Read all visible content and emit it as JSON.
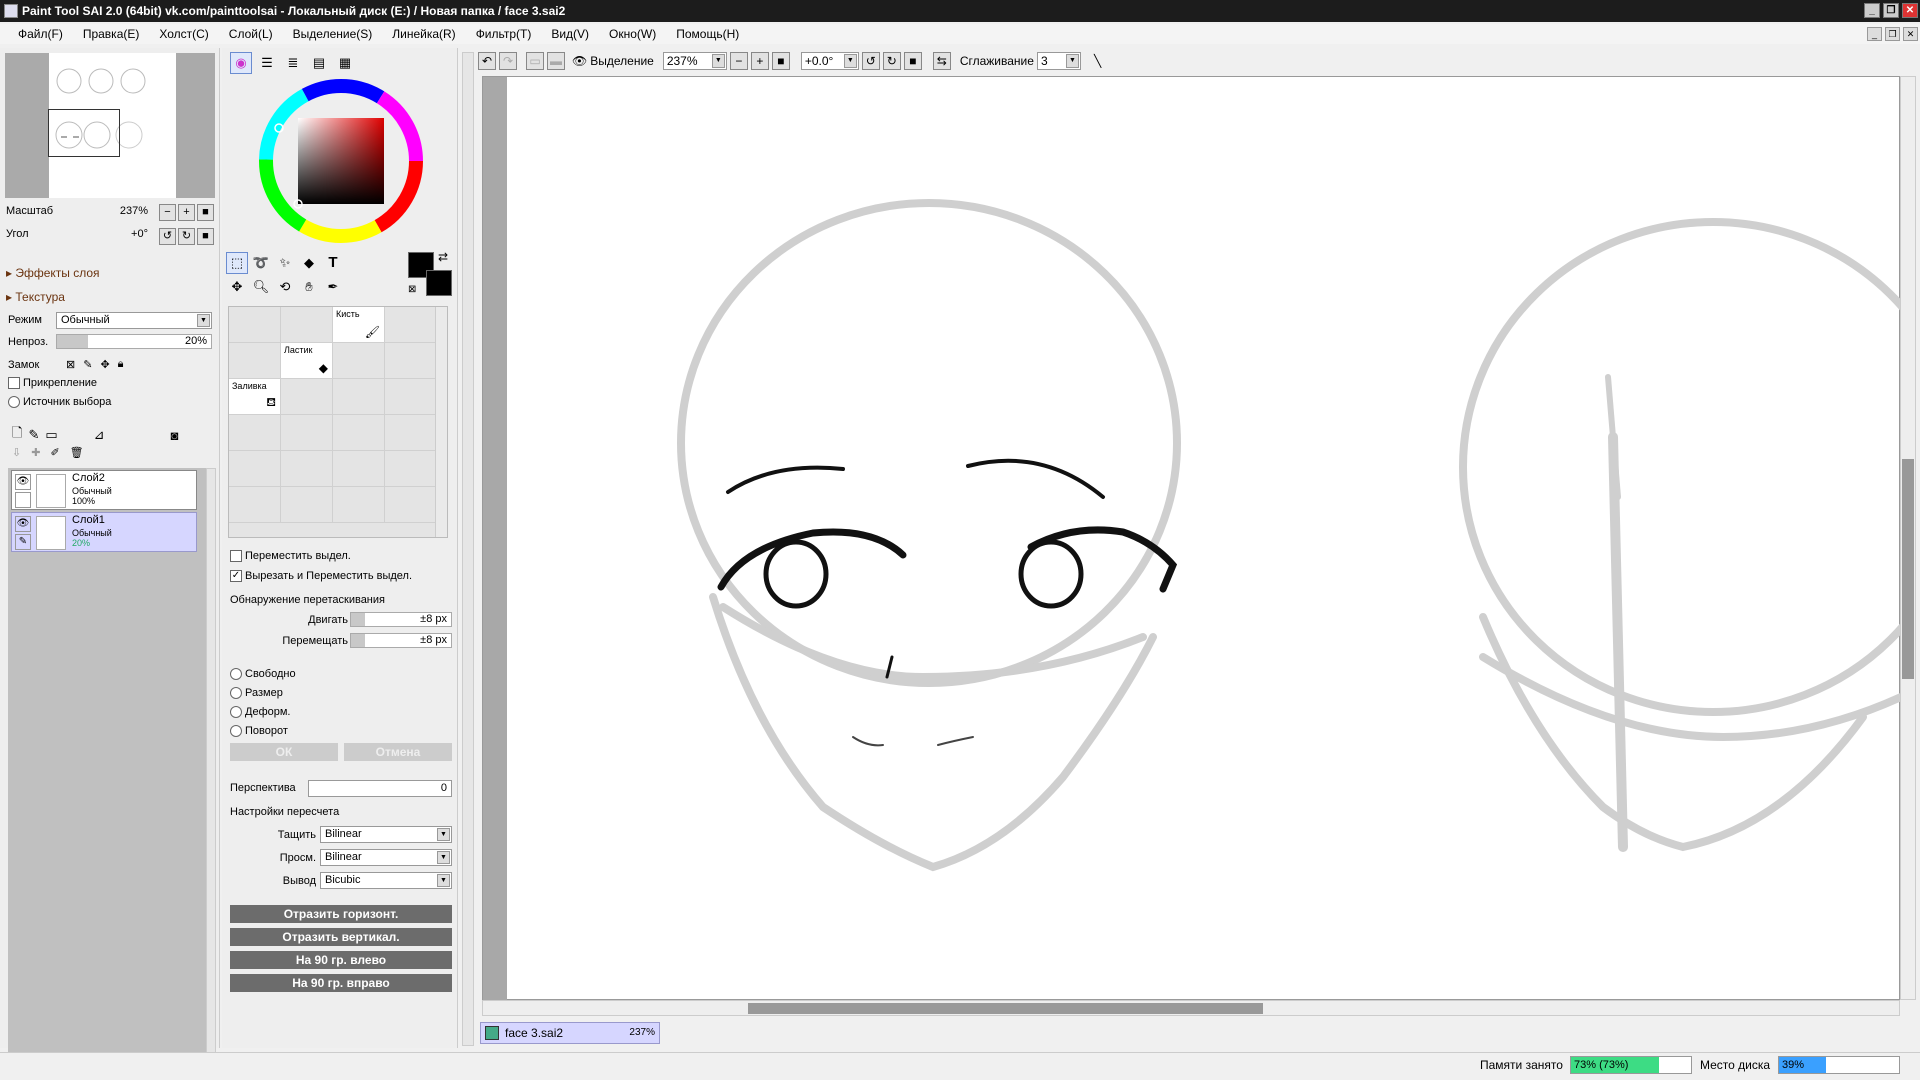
{
  "window": {
    "title": "Paint Tool SAI 2.0 (64bit) vk.com/painttoolsai - Локальный диск (E:) / Новая папка / face 3.sai2"
  },
  "menu": [
    "Файл(F)",
    "Правка(E)",
    "Холст(C)",
    "Слой(L)",
    "Выделение(S)",
    "Линейка(R)",
    "Фильтр(T)",
    "Вид(V)",
    "Окно(W)",
    "Помощь(H)"
  ],
  "navigator": {
    "zoom_label": "Масштаб",
    "zoom_value": "237%",
    "angle_label": "Угол",
    "angle_value": "+0°"
  },
  "layer_panel": {
    "effects_label": "Эффекты слоя",
    "texture_label": "Текстура",
    "mode_label": "Режим",
    "mode_value": "Обычный",
    "opacity_label": "Непроз.",
    "opacity_value": "20%",
    "opacity_level": 0.2,
    "lock_label": "Замок",
    "clipping_label": "Прикрепление",
    "selection_source_label": "Источник выбора",
    "layers": [
      {
        "name": "Слой2",
        "mode": "Обычный",
        "opacity": "100%",
        "selected": false
      },
      {
        "name": "Слой1",
        "mode": "Обычный",
        "opacity": "20%",
        "selected": true
      }
    ]
  },
  "tools": {
    "brushes": [
      {
        "name": "Кисть",
        "icon": "brush-icon"
      },
      {
        "name": "Ластик",
        "icon": "eraser-icon"
      },
      {
        "name": "Заливка",
        "icon": "bucket-icon"
      }
    ],
    "primary_color": "#000000",
    "secondary_color": "#000000"
  },
  "transform": {
    "move_selection_label": "Переместить выдел.",
    "move_selection_checked": false,
    "cut_move_label": "Вырезать и Переместить выдел.",
    "cut_move_checked": true,
    "drag_detect_label": "Обнаружение перетаскивания",
    "move_label": "Двигать",
    "move_value": "±8 px",
    "shift_label": "Перемещать",
    "shift_value": "±8 px",
    "modes": [
      "Свободно",
      "Размер",
      "Деформ.",
      "Поворот"
    ],
    "ok_label": "ОК",
    "cancel_label": "Отмена",
    "perspective_label": "Перспектива",
    "perspective_value": "0",
    "resample_label": "Настройки пересчета",
    "drag_label": "Тащить",
    "drag_value": "Bilinear",
    "preview_label": "Просм.",
    "preview_value": "Bilinear",
    "output_label": "Вывод",
    "output_value": "Bicubic",
    "flip_h_label": "Отразить горизонт.",
    "flip_v_label": "Отразить вертикал.",
    "rot_left_label": "На 90 гр. влево",
    "rot_right_label": "На 90 гр. вправо"
  },
  "toolbar": {
    "selection_label": "Выделение",
    "zoom_value": "237%",
    "angle_value": "+0.0°",
    "smoothing_label": "Сглаживание",
    "smoothing_value": "3"
  },
  "document_tab": {
    "name": "face 3.sai2",
    "zoom": "237%"
  },
  "status": {
    "memory_label": "Памяти занято",
    "memory_value": "73% (73%)",
    "memory_level": 0.73,
    "memory_color": "#3ddc84",
    "disk_label": "Место диска",
    "disk_value": "39%",
    "disk_level": 0.39,
    "disk_color": "#3aa0ff"
  }
}
